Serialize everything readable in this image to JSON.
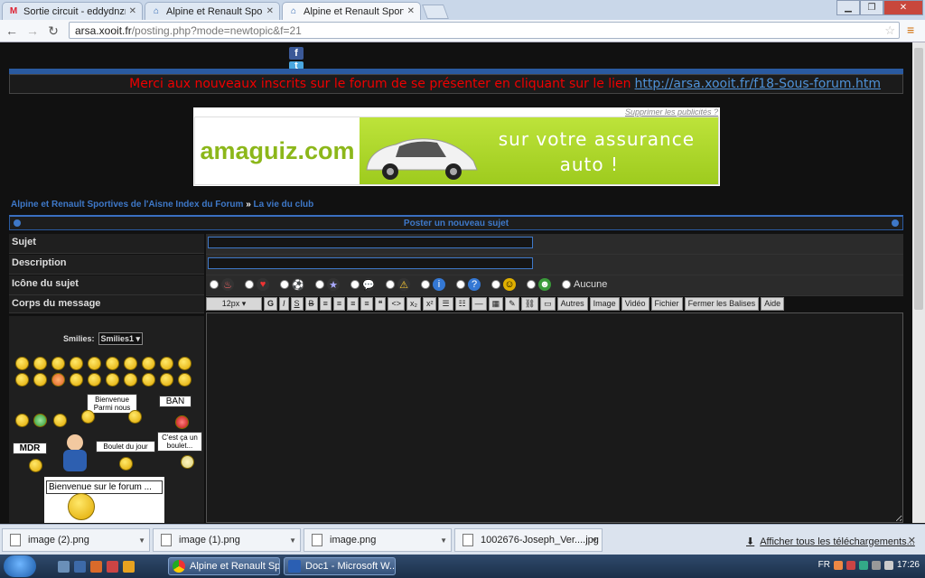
{
  "browser": {
    "tabs": [
      {
        "title": "Sortie circuit - eddydnzrt@",
        "favicon": "gmail-icon",
        "active": false
      },
      {
        "title": "Alpine et Renault Sportive",
        "favicon": "site-icon",
        "active": false
      },
      {
        "title": "Alpine et Renault Sportive",
        "favicon": "site-icon",
        "active": true
      }
    ],
    "url_host": "arsa.xooit.fr",
    "url_path": "/posting.php?mode=newtopic&f=21"
  },
  "page": {
    "announcement_text": "Merci aux nouveaux inscrits sur le forum de se présenter en cliquant sur le lien",
    "announcement_link": "http://arsa.xooit.fr/f18-Sous-forum.htm",
    "ad": {
      "remove_label": "Supprimer les publicités ?",
      "logo": "amaguiz.com",
      "line1": "sur votre assurance",
      "line2": "auto !"
    },
    "breadcrumb": {
      "forum_index": "Alpine et Renault Sportives de l'Aisne Index du Forum",
      "separator": "»",
      "section": "La vie du club"
    },
    "form": {
      "header": "Poster un nouveau sujet",
      "subject_label": "Sujet",
      "description_label": "Description",
      "icon_label": "Icône du sujet",
      "icon_none": "Aucune",
      "body_label": "Corps du message",
      "toolbar": {
        "font_size": "12px",
        "bold": "G",
        "italic": "I",
        "underline": "S",
        "strike": "B",
        "autres": "Autres",
        "image": "Image",
        "video": "Vidéo",
        "fichier": "Fichier",
        "fermer": "Fermer les Balises",
        "aide": "Aide"
      },
      "smilies_label": "Smilies:",
      "smilies_select": "Smilies1",
      "signs": {
        "bienvenue": "Bienvenue Parmi nous",
        "ban": "BAN",
        "mdr": "MDR",
        "boulet": "Boulet du jour",
        "cestca": "C'est ça un boulet...",
        "welcome_forum": "Bienvenue sur le forum ..."
      }
    }
  },
  "downloads": {
    "items": [
      "image (2).png",
      "image (1).png",
      "image.png",
      "1002676-Joseph_Ver....jpg"
    ],
    "show_all": "Afficher tous les téléchargements..."
  },
  "taskbar": {
    "items": [
      "Alpine et Renault Sp...",
      "Doc1 - Microsoft W..."
    ],
    "lang": "FR",
    "time": "17:26"
  },
  "colors": {
    "accent": "#3e78c8",
    "announce": "#e00000",
    "ad_green": "#9ecb1e"
  }
}
